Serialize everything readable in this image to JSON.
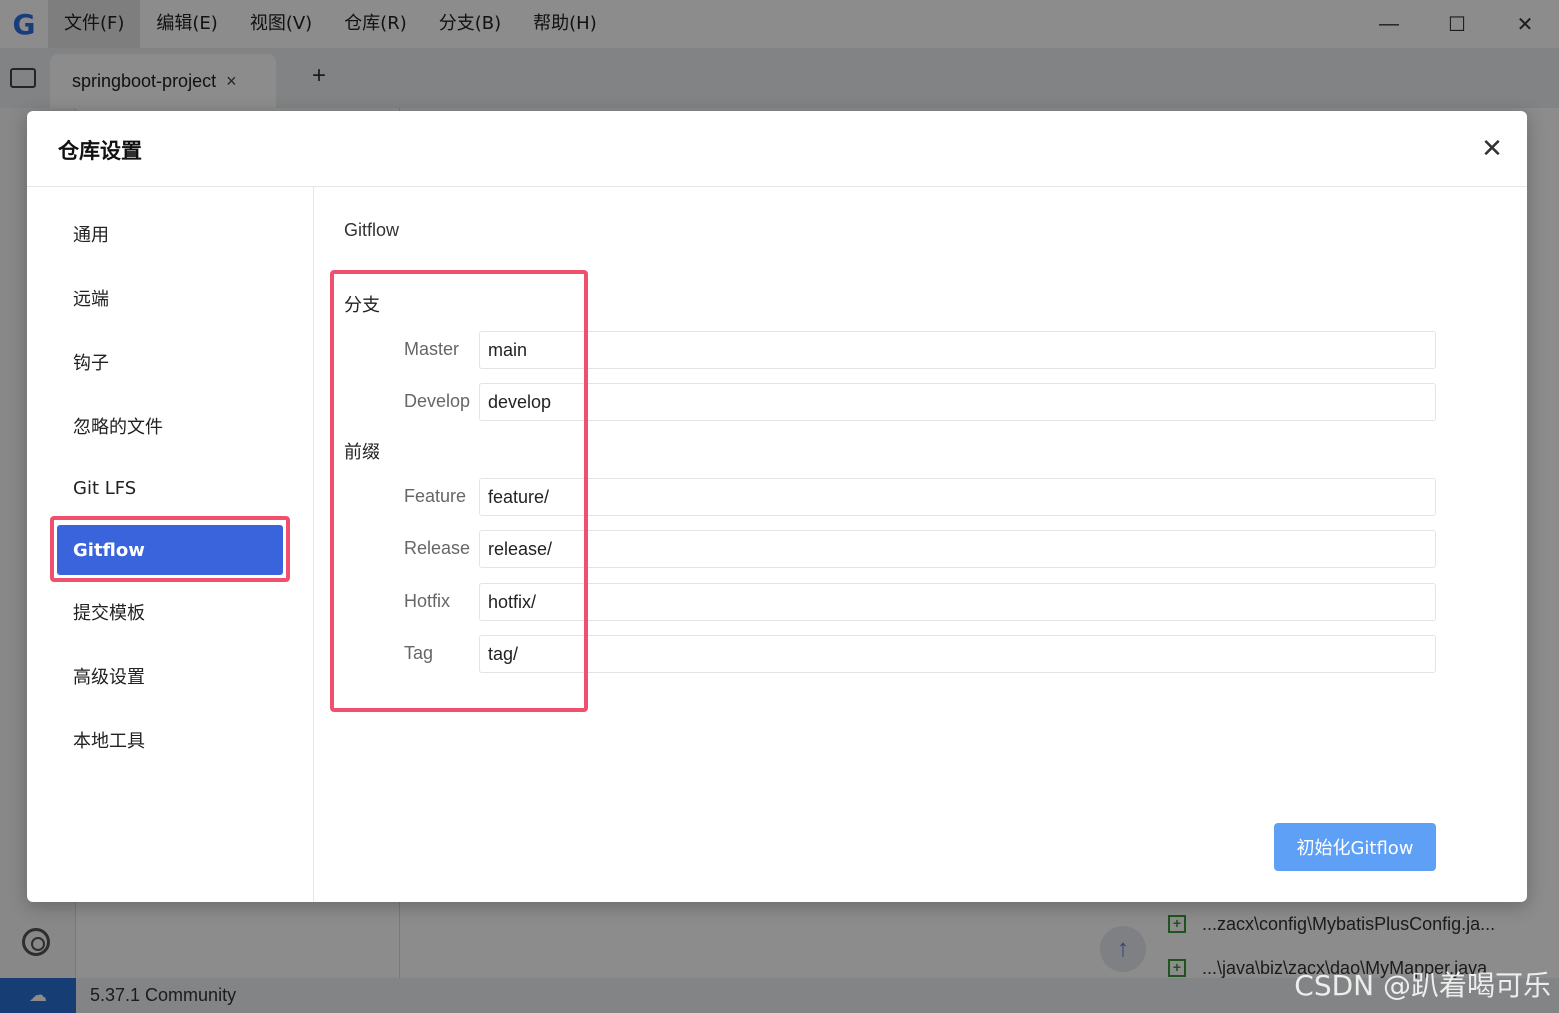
{
  "menubar": {
    "logo": "G",
    "items": [
      "文件(F)",
      "编辑(E)",
      "视图(V)",
      "仓库(R)",
      "分支(B)",
      "帮助(H)"
    ],
    "minimize": "—",
    "maximize": "☐",
    "close": "✕"
  },
  "tabs": {
    "project": "springboot-project",
    "close": "×",
    "add": "+"
  },
  "background": {
    "files": [
      "...zacx\\config\\MybatisPlusConfig.ja...",
      "...\\java\\biz\\zacx\\dao\\MyMapper.java"
    ],
    "up_arrow": "↑"
  },
  "statusbar": {
    "version": "5.37.1 Community",
    "cloud": "☁"
  },
  "dialog": {
    "title": "仓库设置",
    "close": "✕",
    "nav": [
      "通用",
      "远端",
      "钩子",
      "忽略的文件",
      "Git LFS",
      "Gitflow",
      "提交模板",
      "高级设置",
      "本地工具"
    ],
    "selected_nav": "Gitflow",
    "section_title": "Gitflow",
    "branch_group": "分支",
    "prefix_group": "前缀",
    "fields": {
      "master": {
        "label": "Master",
        "value": "main"
      },
      "develop": {
        "label": "Develop",
        "value": "develop"
      },
      "feature": {
        "label": "Feature",
        "value": "feature/"
      },
      "release": {
        "label": "Release",
        "value": "release/"
      },
      "hotfix": {
        "label": "Hotfix",
        "value": "hotfix/"
      },
      "tag": {
        "label": "Tag",
        "value": "tag/"
      }
    },
    "init_button": "初始化Gitflow"
  },
  "watermark": "CSDN @趴着喝可乐",
  "colors": {
    "accent": "#3a64dc",
    "button": "#5fa0f7",
    "highlight": "#f0506e"
  }
}
